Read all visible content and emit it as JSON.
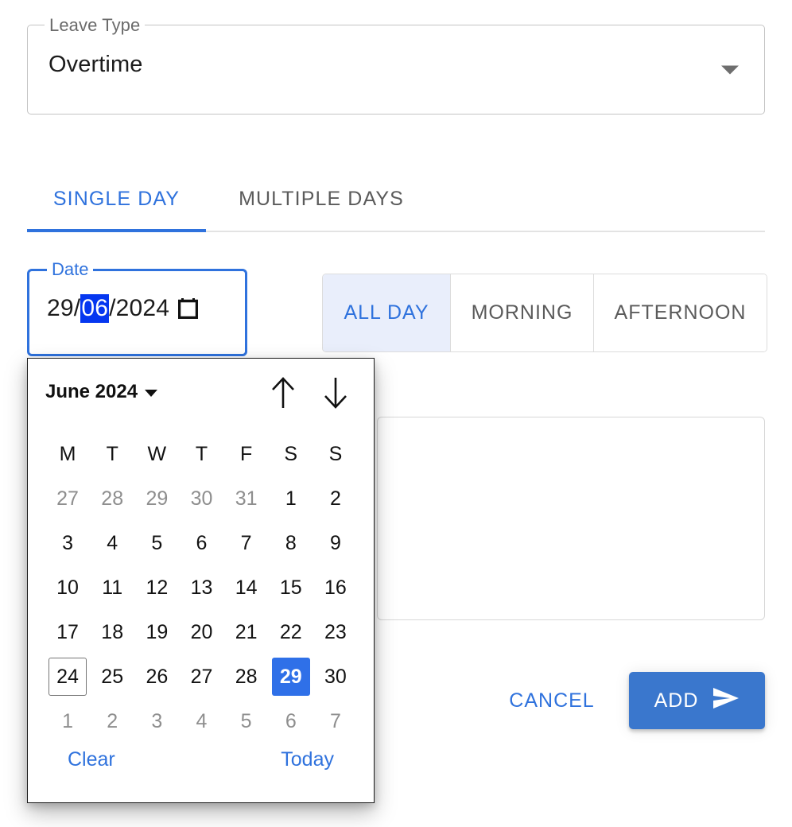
{
  "leave_type": {
    "label": "Leave Type",
    "value": "Overtime",
    "caret_icon": "chevron-down-icon"
  },
  "tabs": [
    {
      "label": "SINGLE DAY",
      "active": true
    },
    {
      "label": "MULTIPLE DAYS",
      "active": false
    }
  ],
  "date_field": {
    "label": "Date",
    "day": "29",
    "month": "06",
    "year": "2024",
    "separator": "/",
    "full_value": "29/06/2024",
    "selected_segment": "month",
    "icon": "calendar-icon"
  },
  "dayparts": [
    {
      "label": "ALL DAY",
      "selected": true
    },
    {
      "label": "MORNING",
      "selected": false
    },
    {
      "label": "AFTERNOON",
      "selected": false
    }
  ],
  "notes": {
    "value": "",
    "placeholder": ""
  },
  "actions": {
    "cancel_label": "CANCEL",
    "add_label": "ADD",
    "add_icon": "send-icon"
  },
  "calendar": {
    "month_label": "June 2024",
    "month_caret_icon": "chevron-down-icon",
    "prev_icon": "arrow-up-icon",
    "next_icon": "arrow-down-icon",
    "weekdays": [
      "M",
      "T",
      "W",
      "T",
      "F",
      "S",
      "S"
    ],
    "weeks": [
      [
        {
          "day": "27",
          "muted": true
        },
        {
          "day": "28",
          "muted": true
        },
        {
          "day": "29",
          "muted": true
        },
        {
          "day": "30",
          "muted": true
        },
        {
          "day": "31",
          "muted": true
        },
        {
          "day": "1",
          "muted": false
        },
        {
          "day": "2",
          "muted": false
        }
      ],
      [
        {
          "day": "3",
          "muted": false
        },
        {
          "day": "4",
          "muted": false
        },
        {
          "day": "5",
          "muted": false
        },
        {
          "day": "6",
          "muted": false
        },
        {
          "day": "7",
          "muted": false
        },
        {
          "day": "8",
          "muted": false
        },
        {
          "day": "9",
          "muted": false
        }
      ],
      [
        {
          "day": "10",
          "muted": false
        },
        {
          "day": "11",
          "muted": false
        },
        {
          "day": "12",
          "muted": false
        },
        {
          "day": "13",
          "muted": false
        },
        {
          "day": "14",
          "muted": false
        },
        {
          "day": "15",
          "muted": false
        },
        {
          "day": "16",
          "muted": false
        }
      ],
      [
        {
          "day": "17",
          "muted": false
        },
        {
          "day": "18",
          "muted": false
        },
        {
          "day": "19",
          "muted": false
        },
        {
          "day": "20",
          "muted": false
        },
        {
          "day": "21",
          "muted": false
        },
        {
          "day": "22",
          "muted": false
        },
        {
          "day": "23",
          "muted": false
        }
      ],
      [
        {
          "day": "24",
          "muted": false,
          "today": true
        },
        {
          "day": "25",
          "muted": false
        },
        {
          "day": "26",
          "muted": false
        },
        {
          "day": "27",
          "muted": false
        },
        {
          "day": "28",
          "muted": false
        },
        {
          "day": "29",
          "muted": false,
          "selected": true
        },
        {
          "day": "30",
          "muted": false
        }
      ],
      [
        {
          "day": "1",
          "muted": true
        },
        {
          "day": "2",
          "muted": true
        },
        {
          "day": "3",
          "muted": true
        },
        {
          "day": "4",
          "muted": true
        },
        {
          "day": "5",
          "muted": true
        },
        {
          "day": "6",
          "muted": true
        },
        {
          "day": "7",
          "muted": true
        }
      ]
    ],
    "clear_label": "Clear",
    "today_label": "Today"
  },
  "colors": {
    "accent_blue": "#2f72dd",
    "selected_day_blue": "#2f70e8",
    "segment_selected_bg": "#e9eefb",
    "text_selection_blue": "#0537f0",
    "add_button_blue": "#3a77cd",
    "muted_text": "#8e8e8e",
    "border_gray": "#c4c4c4"
  }
}
